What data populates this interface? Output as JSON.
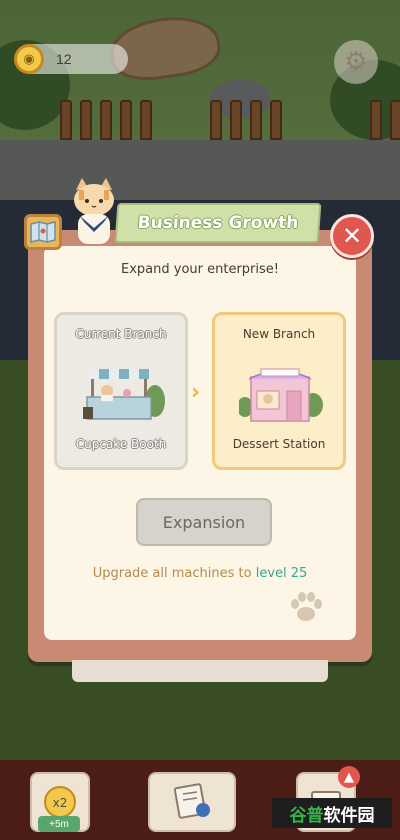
{
  "hud": {
    "coin_icon": "cat-coin-icon",
    "coin_count": "12",
    "settings_icon": "gear-icon"
  },
  "dialog": {
    "title": "Business Growth",
    "subtitle": "Expand your enterprise!",
    "close_icon": "close-icon",
    "current_branch": {
      "header": "Current Branch",
      "name": "Cupcake Booth"
    },
    "new_branch": {
      "header": "New Branch",
      "name": "Dessert Station"
    },
    "arrow_icon": "chevron-right-icon",
    "expansion_label": "Expansion",
    "requirement_text": "Upgrade all machines to ",
    "requirement_level": "level 25"
  },
  "bottom_bar": {
    "boost_badge": "+5m",
    "boost_multiplier": "x2"
  },
  "watermark": {
    "prefix": "谷普",
    "suffix": "软件园"
  },
  "colors": {
    "accent_green": "#3aa58f",
    "dialog_frame": "#c98a74",
    "close_red": "#e0574f"
  }
}
